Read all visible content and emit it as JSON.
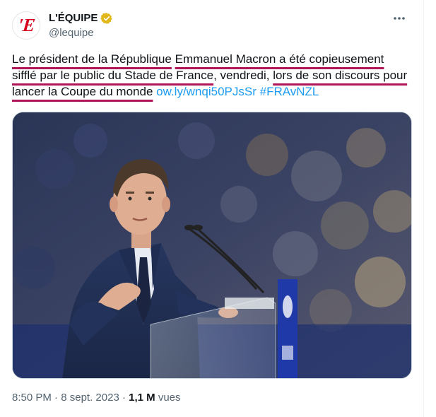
{
  "account": {
    "display_name": "L'ÉQUIPE",
    "handle": "@lequipe",
    "avatar_letter": "'E"
  },
  "tweet": {
    "segments": [
      {
        "text": "Le président de la République",
        "highlight": true
      },
      {
        "text": " ",
        "highlight": false
      },
      {
        "text": "Emmanuel Macron a été copieusement sifflé par le public du Stade de France",
        "highlight": true
      },
      {
        "text": ", vendredi, ",
        "highlight": false
      },
      {
        "text": "lors de son discours pour lancer la Coupe du monde",
        "highlight": true
      },
      {
        "text": " ",
        "highlight": false
      }
    ],
    "link": "ow.ly/wnqi50PJsSr",
    "hashtag": "#FRAvNZL"
  },
  "meta": {
    "time": "8:50 PM",
    "separator1": " · ",
    "date": "8 sept. 2023",
    "separator2": " · ",
    "views_count": "1,1 M",
    "views_label": " vues"
  },
  "colors": {
    "highlight_underline": "#b0155a",
    "link": "#1d9bf0",
    "verified_badge": "#e2b719",
    "brand_red": "#d6001c"
  },
  "icons": {
    "verified": "verified-badge-icon",
    "more": "more-dots-icon"
  }
}
